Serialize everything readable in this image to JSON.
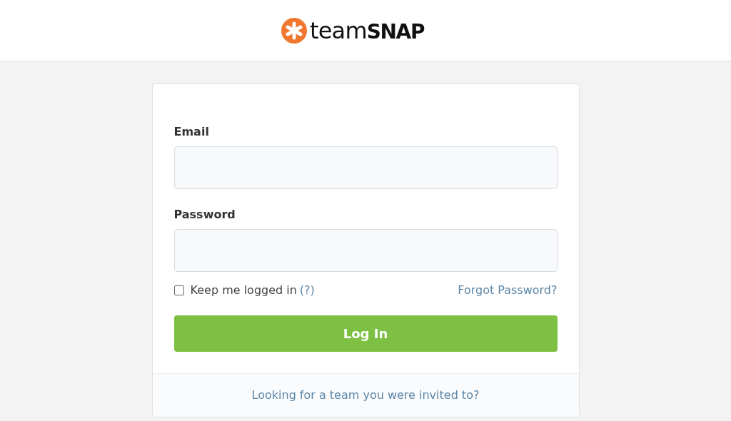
{
  "logo": {
    "word_light": "team",
    "word_bold": "SNAP"
  },
  "form": {
    "fields": [
      {
        "label": "Email"
      },
      {
        "label": "Password"
      }
    ],
    "remember": {
      "label": "Keep me logged in",
      "help": "(?)",
      "checked": false
    },
    "forgot_link": "Forgot Password?",
    "submit": "Log In"
  },
  "footer_link": "Looking for a team you were invited to?"
}
